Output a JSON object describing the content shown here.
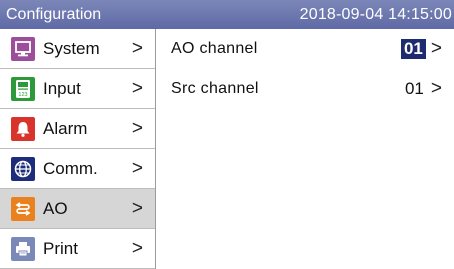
{
  "header": {
    "title": "Configuration",
    "datetime": "2018-09-04 14:15:00"
  },
  "sidebar": {
    "items": [
      {
        "label": "System",
        "icon": "monitor-icon",
        "color": "#9b4f9b",
        "chevron": ">"
      },
      {
        "label": "Input",
        "icon": "input-meter-icon",
        "color": "#2c9a3a",
        "chevron": ">"
      },
      {
        "label": "Alarm",
        "icon": "bell-icon",
        "color": "#d9342b",
        "chevron": ">"
      },
      {
        "label": "Comm.",
        "icon": "globe-icon",
        "color": "#1e2d7a",
        "chevron": ">"
      },
      {
        "label": "AO",
        "icon": "ao-arrows-icon",
        "color": "#e8811e",
        "chevron": ">",
        "selected": true
      },
      {
        "label": "Print",
        "icon": "printer-icon",
        "color": "#7b89b8",
        "chevron": ">"
      }
    ],
    "icon_detail": {
      "input_meter_text": "123"
    }
  },
  "main": {
    "rows": [
      {
        "label": "AO channel",
        "value": "01",
        "chevron": ">"
      },
      {
        "label": "Src channel",
        "value": "01",
        "chevron": ">"
      }
    ]
  },
  "colors": {
    "titlebar": "#6a74ad",
    "selected_bg": "#d6d6d6",
    "value_highlight": "#1e2b6e"
  }
}
